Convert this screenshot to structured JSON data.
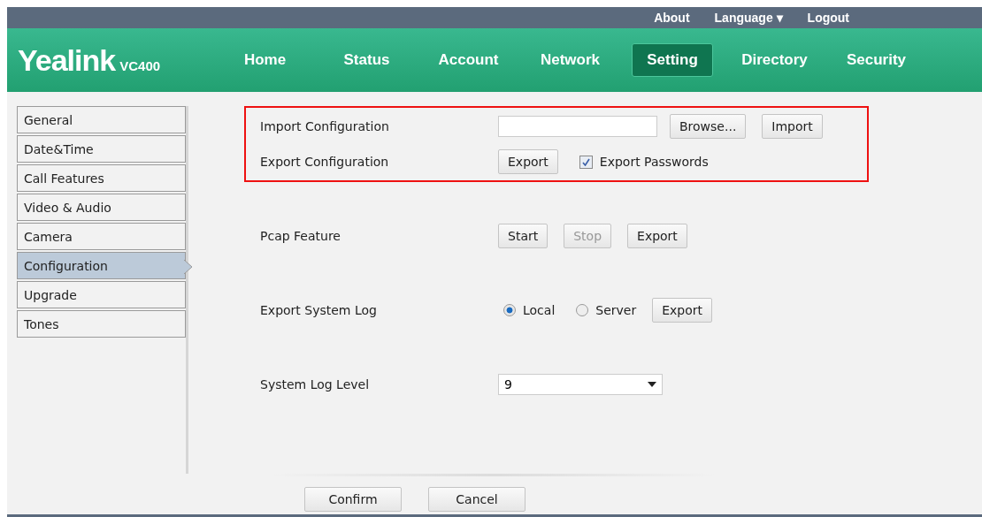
{
  "top_links": [
    {
      "label": "About",
      "kind": "link"
    },
    {
      "label": "Language ▾",
      "kind": "link"
    },
    {
      "label": "Logout",
      "kind": "link"
    }
  ],
  "logo": {
    "brand": "Yealink",
    "model": "VC400"
  },
  "nav": [
    {
      "label": "Home",
      "selected": false
    },
    {
      "label": "Status",
      "selected": false
    },
    {
      "label": "Account",
      "selected": false
    },
    {
      "label": "Network",
      "selected": false
    },
    {
      "label": "Setting",
      "selected": true
    },
    {
      "label": "Directory",
      "selected": false
    },
    {
      "label": "Security",
      "selected": false
    }
  ],
  "sidebar": {
    "items": [
      {
        "label": "General",
        "selected": false
      },
      {
        "label": "Date&Time",
        "selected": false
      },
      {
        "label": "Call Features",
        "selected": false
      },
      {
        "label": "Video & Audio",
        "selected": false
      },
      {
        "label": "Camera",
        "selected": false
      },
      {
        "label": "Configuration",
        "selected": true
      },
      {
        "label": "Upgrade",
        "selected": false
      },
      {
        "label": "Tones",
        "selected": false
      }
    ]
  },
  "sections": [
    {
      "highlighted": true,
      "rows": [
        {
          "label": "Import Configuration",
          "controls": [
            {
              "kind": "file"
            },
            {
              "kind": "button",
              "label": "Browse...",
              "disabled": false
            },
            {
              "kind": "button",
              "label": "Import",
              "disabled": false
            }
          ]
        },
        {
          "label": "Export Configuration",
          "controls": [
            {
              "kind": "button",
              "label": "Export",
              "disabled": false
            },
            {
              "kind": "checkbox",
              "label": "Export Passwords",
              "checked": true
            }
          ]
        }
      ]
    },
    {
      "highlighted": false,
      "rows": [
        {
          "label": "Pcap Feature",
          "controls": [
            {
              "kind": "button",
              "label": "Start",
              "disabled": false
            },
            {
              "kind": "button",
              "label": "Stop",
              "disabled": true
            },
            {
              "kind": "button",
              "label": "Export",
              "disabled": false
            }
          ]
        }
      ]
    },
    {
      "highlighted": false,
      "rows": [
        {
          "label": "Export System Log",
          "controls": [
            {
              "kind": "radio",
              "label": "Local",
              "selected": true
            },
            {
              "kind": "radio",
              "label": "Server",
              "selected": false
            },
            {
              "kind": "button",
              "label": "Export",
              "disabled": false
            }
          ]
        }
      ]
    },
    {
      "highlighted": false,
      "rows": [
        {
          "label": "System Log Level",
          "controls": [
            {
              "kind": "select",
              "value": "9"
            }
          ]
        }
      ]
    }
  ],
  "footer_buttons": [
    "Confirm",
    "Cancel"
  ]
}
